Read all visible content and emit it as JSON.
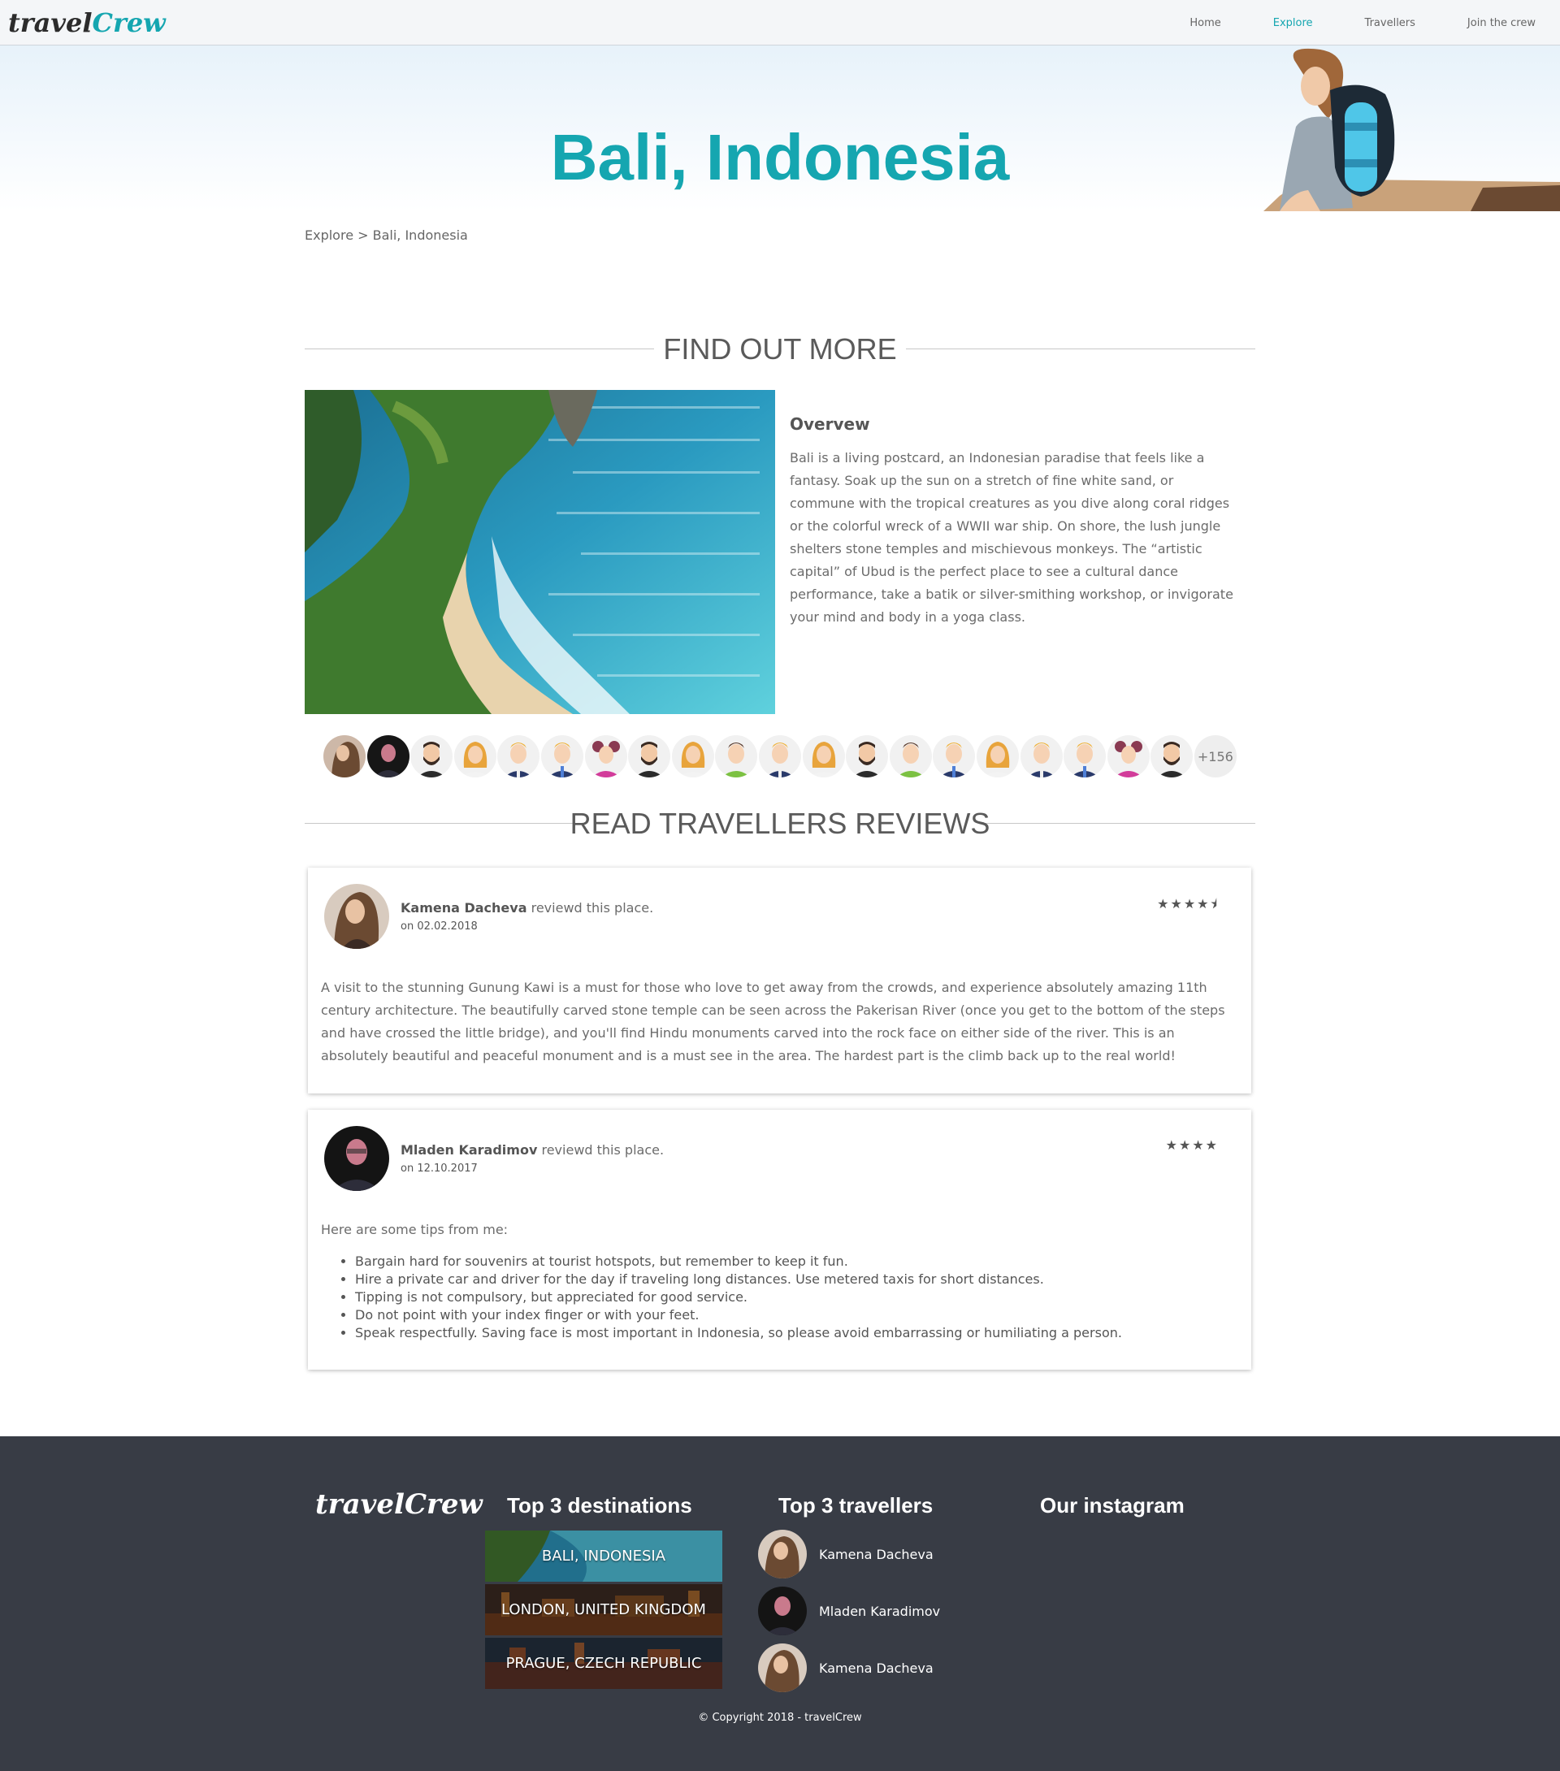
{
  "brand": {
    "logo_part1": "travel",
    "logo_part2": "Crew"
  },
  "nav": {
    "items": [
      {
        "label": "Home",
        "active": false
      },
      {
        "label": "Explore",
        "active": true
      },
      {
        "label": "Travellers",
        "active": false
      },
      {
        "label": "Join the crew",
        "active": false
      }
    ]
  },
  "hero": {
    "title": "Bali, Indonesia"
  },
  "breadcrumb": "Explore > Bali, Indonesia",
  "find_out_more": {
    "heading": "FIND OUT MORE",
    "overview_title": "Overvew",
    "overview_text": "Bali is a living postcard, an Indonesian paradise that feels like a fantasy. Soak up the sun on a stretch of fine white sand, or commune with the tropical creatures as you dive along coral ridges or the colorful wreck of a WWII war ship. On shore, the lush jungle shelters stone temples and mischievous monkeys. The “artistic capital” of Ubud is the perfect place to see a cultural dance performance, take a batik or silver-smithing workshop, or invigorate your mind and body in a yoga class."
  },
  "travellers_strip": {
    "more_count": "+156"
  },
  "reviews": {
    "heading": "READ TRAVELLERS REVIEWS",
    "verb": "reviewd this place.",
    "items": [
      {
        "author": "Kamena Dacheva",
        "date": "on 02.02.2018",
        "rating": 4.5,
        "stars": "★★★★⯨",
        "text": "A visit to the stunning Gunung Kawi is a must for those who love to get away from the crowds, and experience absolutely amazing 11th century architecture. The beautifully carved stone temple can be seen across the Pakerisan River (once you get to the bottom of the steps and have crossed the little bridge), and you'll find Hindu monuments carved into the rock face on either side of the river. This is an absolutely beautiful and peaceful monument and is a must see in the area. The hardest part is the climb back up to the real world!"
      },
      {
        "author": "Mladen Karadimov",
        "date": "on 12.10.2017",
        "rating": 4,
        "stars": "★★★★",
        "intro": "Here are some tips from me:",
        "tips": [
          "Bargain hard for souvenirs at tourist hotspots, but remember to keep it fun.",
          "Hire a private car and driver for the day if traveling long distances. Use metered taxis for short distances.",
          "Tipping is not compulsory, but appreciated for good service.",
          "Do not point with your index finger or with your feet.",
          "Speak respectfully. Saving face is most important in Indonesia, so please avoid embarrassing or humiliating a person."
        ]
      }
    ]
  },
  "footer": {
    "logo_part1": "travel",
    "logo_part2": "Crew",
    "destinations_heading": "Top 3 destinations",
    "destinations": [
      "BALI, INDONESIA",
      "LONDON, UNITED KINGDOM",
      "PRAGUE, CZECH REPUBLIC"
    ],
    "travellers_heading": "Top 3 travellers",
    "travellers": [
      "Kamena Dacheva",
      "Mladen Karadimov",
      "Kamena Dacheva"
    ],
    "instagram_heading": "Our instagram",
    "copyright": "© Copyright 2018 - travelCrew"
  },
  "colors": {
    "accent": "#15a6b0",
    "footer_bg": "#383c45",
    "text": "#6b6b6b"
  }
}
